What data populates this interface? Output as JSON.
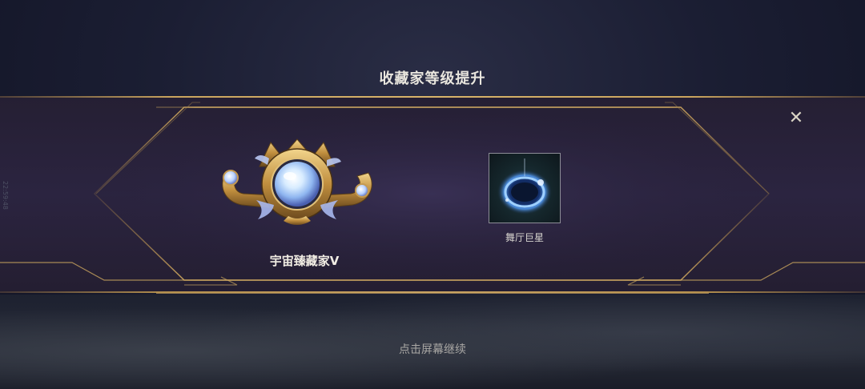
{
  "dialog": {
    "title": "收藏家等级提升",
    "close_icon": "close-icon"
  },
  "rank": {
    "name": "宇宙臻藏家Ⅴ",
    "emblem_icon": "cosmic-collector-emblem-icon"
  },
  "reward": {
    "label": "舞厅巨星",
    "icon": "dance-hall-star-icon"
  },
  "footer": {
    "continue_hint": "点击屏幕继续"
  },
  "side_watermark": "22:59:48",
  "colors": {
    "gold_accent": "#c9a45e",
    "band_purple": "#2b2440",
    "text_light": "#f1ede4"
  }
}
